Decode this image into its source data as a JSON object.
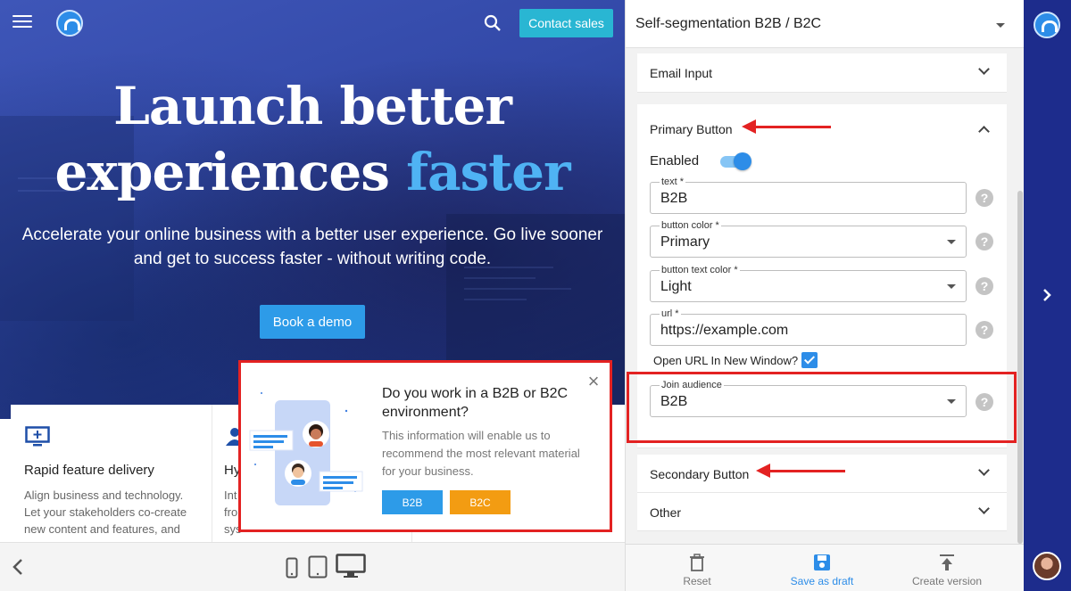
{
  "preview": {
    "topbar": {
      "contact_label": "Contact sales"
    },
    "hero": {
      "title_line1": "Launch better",
      "title_line2_main": "experiences ",
      "title_line2_accent": "faster",
      "subtitle_line1": "Accelerate your online business with a better user experience. Go live sooner",
      "subtitle_line2": "and get to success faster - without writing code.",
      "cta_label": "Book a demo"
    },
    "cards": [
      {
        "title": "Rapid feature delivery",
        "lines": [
          "Align business and technology.",
          "Let your stakeholders co-create",
          "new content and features, and"
        ]
      },
      {
        "title": "Hy",
        "lines": [
          "Int",
          "fro",
          "sys"
        ]
      }
    ],
    "popup": {
      "title": "Do you work in a B2B or B2C environment?",
      "text": "This information will enable us to recommend the most relevant material for your business.",
      "b2b_label": "B2B",
      "b2c_label": "B2C"
    }
  },
  "panel": {
    "title": "Self-segmentation B2B / B2C",
    "sections": {
      "email_input": "Email Input",
      "primary_button": "Primary Button",
      "secondary_button": "Secondary Button",
      "other": "Other"
    },
    "enabled_label": "Enabled",
    "fields": {
      "text": {
        "label": "text *",
        "value": "B2B"
      },
      "button_color": {
        "label": "button color *",
        "value": "Primary"
      },
      "button_text_color": {
        "label": "button text color *",
        "value": "Light"
      },
      "url": {
        "label": "url *",
        "value": "https://example.com"
      },
      "join_audience": {
        "label": "Join audience",
        "value": "B2B"
      }
    },
    "open_new_window_label": "Open URL In New Window?",
    "help_glyph": "?",
    "footer": {
      "reset": "Reset",
      "save_draft": "Save as draft",
      "create_version": "Create version"
    }
  },
  "colors": {
    "accent_blue": "#2d8de8",
    "contact_teal": "#29b6d3",
    "b2c_orange": "#f39c12",
    "annotation_red": "#e32222",
    "rail_navy": "#1d2c8c",
    "save_draft_blue": "#2d8de8"
  },
  "icons": [
    "menu-icon",
    "logo-icon",
    "search-icon",
    "close-icon",
    "monitor-icon",
    "person-icon",
    "back-icon",
    "phone-icon",
    "tablet-icon",
    "desktop-icon",
    "trash-icon",
    "save-icon",
    "upload-icon",
    "chevron-right-icon",
    "help-icon"
  ]
}
